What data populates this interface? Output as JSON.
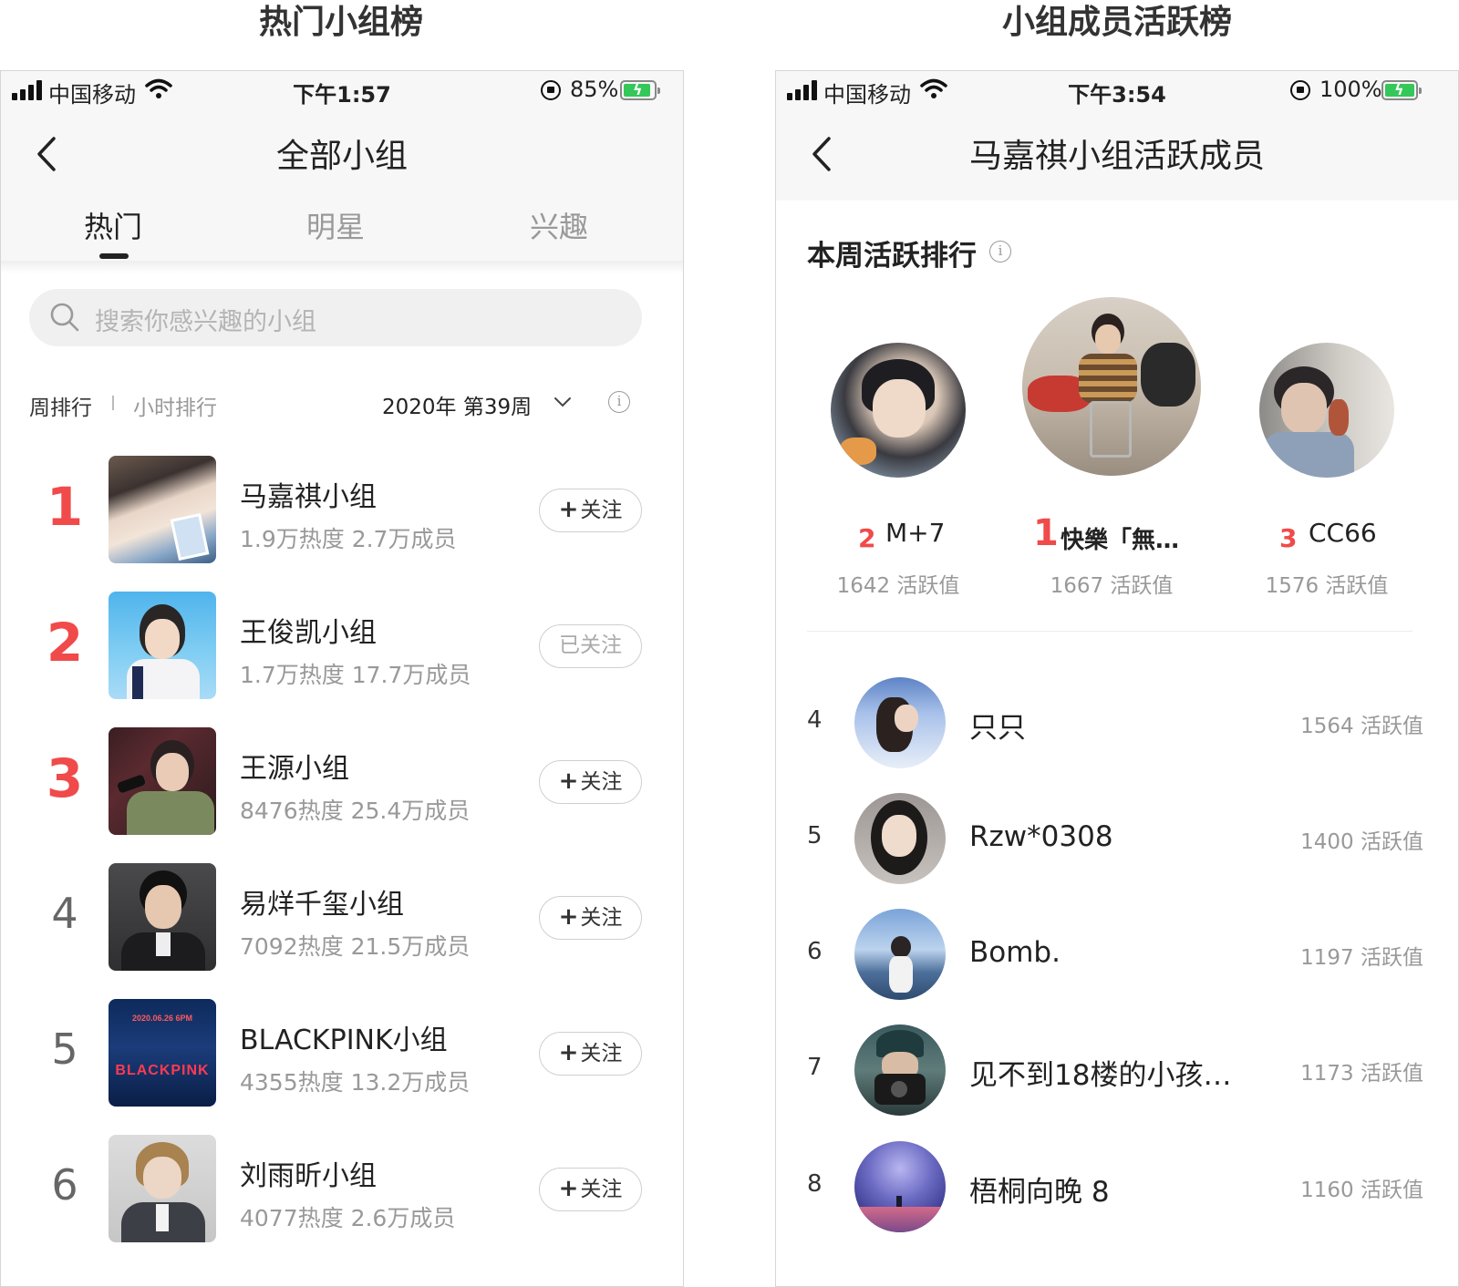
{
  "captions": {
    "left": "热门小组榜",
    "right": "小组成员活跃榜"
  },
  "left_screen": {
    "status": {
      "carrier": "中国移动",
      "time": "下午1:57",
      "battery": "85%"
    },
    "nav": {
      "title": "全部小组"
    },
    "tabs": [
      {
        "label": "热门",
        "active": true
      },
      {
        "label": "明星",
        "active": false
      },
      {
        "label": "兴趣",
        "active": false
      }
    ],
    "search": {
      "placeholder": "搜索你感兴趣的小组"
    },
    "ranking": {
      "weekly": "周排行",
      "hourly": "小时排行",
      "period": "2020年 第39周"
    },
    "groups": [
      {
        "rank": "1",
        "name": "马嘉祺小组",
        "meta": "1.9万热度 2.7万成员",
        "button": "关注",
        "followed": false,
        "thumb": "thumb-1"
      },
      {
        "rank": "2",
        "name": "王俊凯小组",
        "meta": "1.7万热度 17.7万成员",
        "button": "已关注",
        "followed": true,
        "thumb": "thumb-2"
      },
      {
        "rank": "3",
        "name": "王源小组",
        "meta": "8476热度 25.4万成员",
        "button": "关注",
        "followed": false,
        "thumb": "thumb-3"
      },
      {
        "rank": "4",
        "name": "易烊千玺小组",
        "meta": "7092热度 21.5万成员",
        "button": "关注",
        "followed": false,
        "thumb": "thumb-4"
      },
      {
        "rank": "5",
        "name": "BLACKPINK小组",
        "meta": "4355热度 13.2万成员",
        "button": "关注",
        "followed": false,
        "thumb": "thumb-5"
      },
      {
        "rank": "6",
        "name": "刘雨昕小组",
        "meta": "4077热度 2.6万成员",
        "button": "关注",
        "followed": false,
        "thumb": "thumb-6"
      }
    ],
    "poster_text": {
      "date": "2020.06.26 6PM",
      "brand": "BLACKPINK"
    }
  },
  "right_screen": {
    "status": {
      "carrier": "中国移动",
      "time": "下午3:54",
      "battery": "100%"
    },
    "nav": {
      "title": "马嘉祺小组活跃成员"
    },
    "section_title": "本周活跃排行",
    "podium": [
      {
        "rank": "2",
        "name": "M+7",
        "score": "1642 活跃值"
      },
      {
        "rank": "1",
        "name": "快樂「無…",
        "score": "1667 活跃值"
      },
      {
        "rank": "3",
        "name": "CC66",
        "score": "1576 活跃值"
      }
    ],
    "members": [
      {
        "rank": "4",
        "name": "只只",
        "score": "1564 活跃值"
      },
      {
        "rank": "5",
        "name": "Rzw*0308",
        "score": "1400 活跃值"
      },
      {
        "rank": "6",
        "name": "Bomb.",
        "score": "1197 活跃值"
      },
      {
        "rank": "7",
        "name": "见不到18楼的小孩…",
        "score": "1173 活跃值"
      },
      {
        "rank": "8",
        "name": "梧桐向晚 8",
        "score": "1160 活跃值"
      }
    ]
  },
  "colors": {
    "accent_red": "#f04a4a",
    "battery_green": "#34c759",
    "muted_text": "#999999"
  }
}
